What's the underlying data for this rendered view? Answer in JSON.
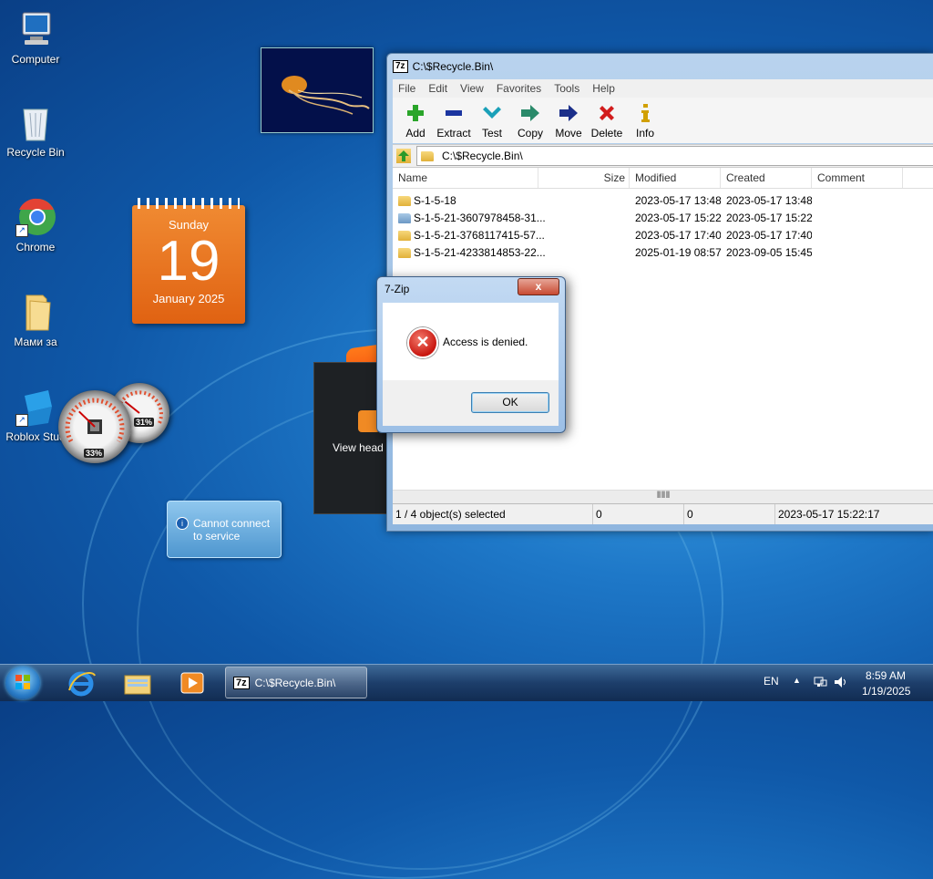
{
  "desktop": {
    "icons": [
      {
        "label": "Computer"
      },
      {
        "label": "Recycle Bin"
      },
      {
        "label": "Chrome"
      },
      {
        "label": "Мами за"
      },
      {
        "label": "Roblox Stud"
      }
    ]
  },
  "gadgets": {
    "calendar": {
      "weekday": "Sunday",
      "day": "19",
      "month_year": "January 2025"
    },
    "cpu_meter": {
      "cpu": "33%",
      "ram": "31%",
      "cpu_level": 0.33,
      "ram_level": 0.31
    },
    "feed": {
      "text": "View head"
    },
    "weather": {
      "text": "Cannot connect to service"
    }
  },
  "window": {
    "title": "C:\\$Recycle.Bin\\",
    "logo": "7z",
    "menu": [
      "File",
      "Edit",
      "View",
      "Favorites",
      "Tools",
      "Help"
    ],
    "toolbar": [
      {
        "label": "Add",
        "icon": "plus-icon",
        "color": "#2aa52a"
      },
      {
        "label": "Extract",
        "icon": "minus-icon",
        "color": "#1b35a0"
      },
      {
        "label": "Test",
        "icon": "check-icon",
        "color": "#1aa0b8"
      },
      {
        "label": "Copy",
        "icon": "copy-arrow-icon",
        "color": "#2a8a6a"
      },
      {
        "label": "Move",
        "icon": "move-arrow-icon",
        "color": "#1b2f8a"
      },
      {
        "label": "Delete",
        "icon": "delete-x-icon",
        "color": "#d21c1c"
      },
      {
        "label": "Info",
        "icon": "info-icon",
        "color": "#d1a000"
      }
    ],
    "address": "C:\\$Recycle.Bin\\",
    "columns": [
      "Name",
      "Size",
      "Modified",
      "Created",
      "Comment"
    ],
    "rows": [
      {
        "name": "S-1-5-18",
        "size": "",
        "modified": "2023-05-17 13:48",
        "created": "2023-05-17 13:48",
        "comment": "",
        "icon": "folder-icon"
      },
      {
        "name": "S-1-5-21-3607978458-31...",
        "size": "",
        "modified": "2023-05-17 15:22",
        "created": "2023-05-17 15:22",
        "comment": "",
        "icon": "blue-folder-icon"
      },
      {
        "name": "S-1-5-21-3768117415-57...",
        "size": "",
        "modified": "2023-05-17 17:40",
        "created": "2023-05-17 17:40",
        "comment": "",
        "icon": "folder-icon"
      },
      {
        "name": "S-1-5-21-4233814853-22...",
        "size": "",
        "modified": "2025-01-19 08:57",
        "created": "2023-09-05 15:45",
        "comment": "",
        "icon": "folder-icon"
      }
    ],
    "scroll_grip": "ⅡⅡⅡ",
    "status": {
      "selection": "1 / 4 object(s) selected",
      "size": "0",
      "packed": "0",
      "date": "2023-05-17 15:22:17"
    }
  },
  "dialog": {
    "title": "7-Zip",
    "close": "x",
    "message": "Access is denied.",
    "ok": "OK"
  },
  "taskbar": {
    "active_task": "C:\\$Recycle.Bin\\",
    "task_logo": "7z",
    "language": "EN",
    "time": "8:59 AM",
    "date": "1/19/2025"
  }
}
